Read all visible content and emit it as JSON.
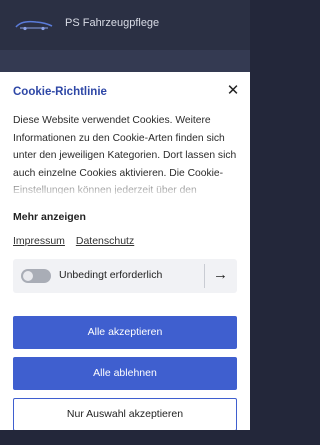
{
  "site": {
    "title": "PS Fahrzeugpflege",
    "logo_icon": "car-logo-icon"
  },
  "cookie_modal": {
    "title": "Cookie-Richtlinie",
    "close_icon": "close-icon",
    "close_symbol": "✕",
    "description": "Diese Website verwendet Cookies. Weitere Informationen zu den Cookie-Arten finden sich unter den jeweiligen Kategorien. Dort lassen sich auch einzelne Cookies aktivieren. Die Cookie-Einstellungen können jederzeit über den",
    "show_more": "Mehr anzeigen",
    "links": {
      "imprint": "Impressum",
      "privacy": "Datenschutz"
    },
    "category": {
      "label": "Unbedingt erforderlich",
      "enabled": true,
      "arrow_icon": "arrow-right-icon",
      "arrow_symbol": "→"
    },
    "buttons": {
      "accept_all": "Alle akzeptieren",
      "reject_all": "Alle ablehnen",
      "accept_selection": "Nur Auswahl akzeptieren"
    },
    "colors": {
      "accent": "#3f5fcf",
      "title": "#2e47a6",
      "header_bg": "#2b3044"
    }
  }
}
